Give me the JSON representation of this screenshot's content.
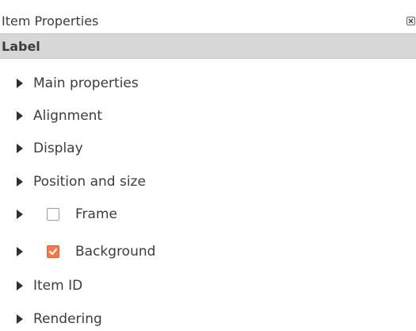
{
  "panel": {
    "title": "Item Properties",
    "close_icon": "close-icon"
  },
  "header": {
    "label": "Label"
  },
  "sections": [
    {
      "label": "Main properties",
      "collapsed": true
    },
    {
      "label": "Alignment",
      "collapsed": true
    },
    {
      "label": "Display",
      "collapsed": true
    },
    {
      "label": "Position and size",
      "collapsed": true
    },
    {
      "label": "Frame",
      "collapsed": true,
      "checked": false
    },
    {
      "label": "Background",
      "collapsed": true,
      "checked": true
    },
    {
      "label": "Item ID",
      "collapsed": true
    },
    {
      "label": "Rendering",
      "collapsed": true
    }
  ],
  "colors": {
    "header_bg": "#d7d7d7",
    "checkbox_checked": "#f17a4e"
  }
}
